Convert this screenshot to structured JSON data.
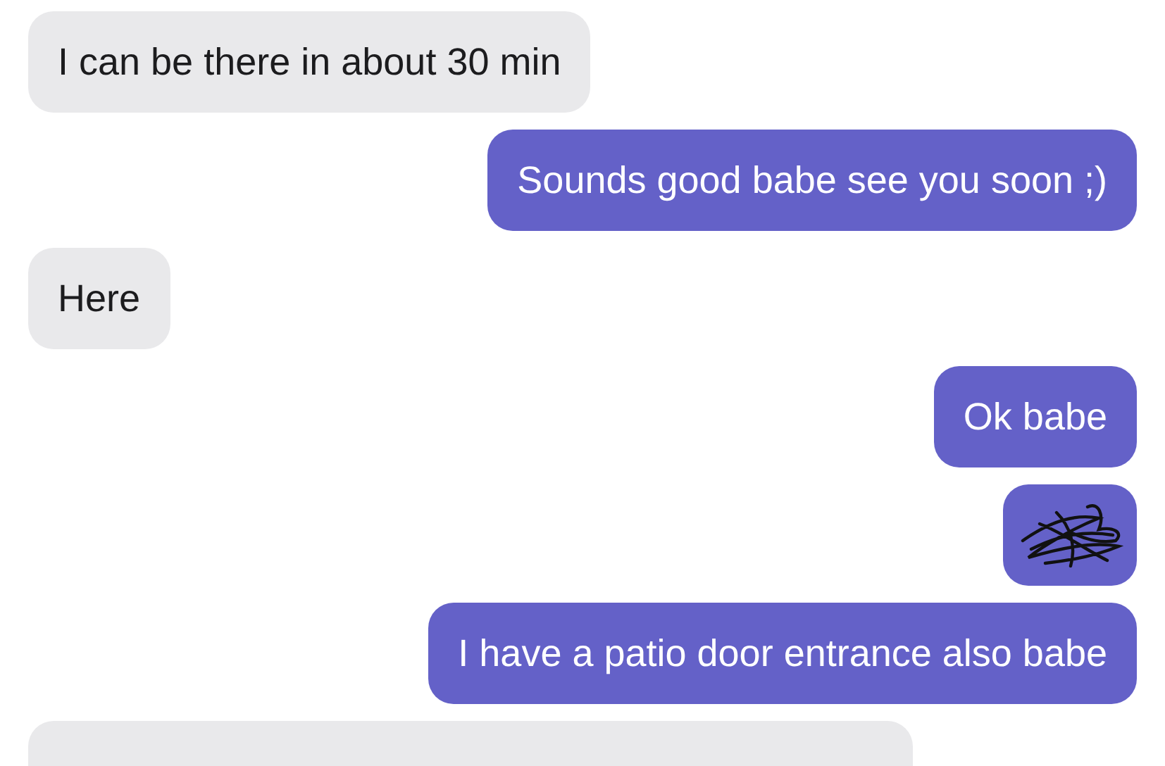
{
  "messages": [
    {
      "kind": "text",
      "outgoing": false,
      "text": "I can be there in about 30 min"
    },
    {
      "kind": "text",
      "outgoing": true,
      "text": "Sounds good babe see you soon ;)"
    },
    {
      "kind": "text",
      "outgoing": false,
      "text": "Here"
    },
    {
      "kind": "text",
      "outgoing": true,
      "text": "Ok babe"
    },
    {
      "kind": "redacted",
      "outgoing": true
    },
    {
      "kind": "text",
      "outgoing": true,
      "text": "I have a patio door entrance also babe"
    },
    {
      "kind": "cut_off",
      "outgoing": false
    }
  ]
}
